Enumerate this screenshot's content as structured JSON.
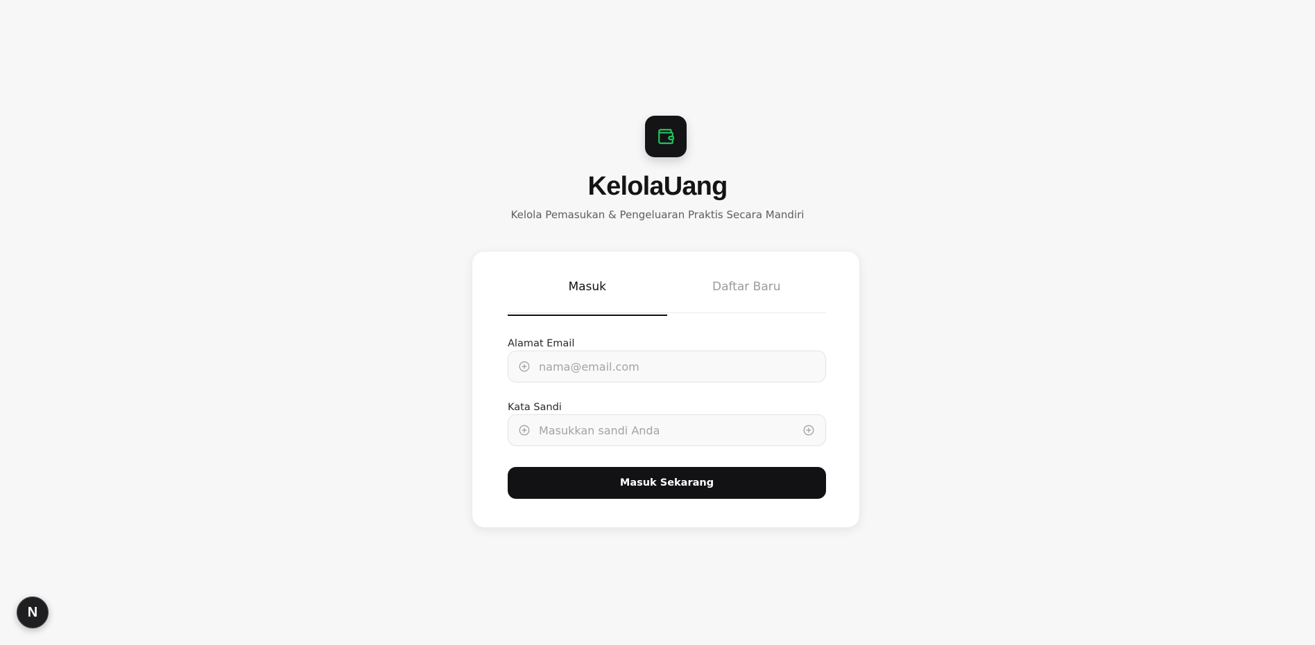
{
  "brand": {
    "title": "KelolaUang",
    "subtitle": "Kelola Pemasukan & Pengeluaran Praktis Secara Mandiri",
    "logo_icon": "wallet-icon",
    "accent_color": "#22c55e"
  },
  "auth": {
    "tabs": [
      {
        "label": "Masuk",
        "active": true
      },
      {
        "label": "Daftar Baru",
        "active": false
      }
    ],
    "email": {
      "label": "Alamat Email",
      "placeholder": "nama@email.com",
      "value": "",
      "icon": "plus-circle-icon"
    },
    "password": {
      "label": "Kata Sandi",
      "placeholder": "Masukkan sandi Anda",
      "value": "",
      "icon": "plus-circle-icon",
      "toggle_icon": "plus-circle-icon"
    },
    "submit_label": "Masuk Sekarang"
  },
  "dev_indicator": {
    "label": "N"
  }
}
